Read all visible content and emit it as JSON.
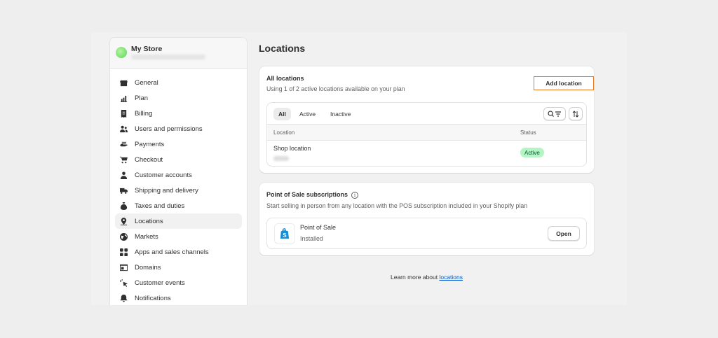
{
  "store": {
    "name": "My Store"
  },
  "sidebar": {
    "items": [
      {
        "label": "General",
        "icon": "store-icon"
      },
      {
        "label": "Plan",
        "icon": "plan-icon"
      },
      {
        "label": "Billing",
        "icon": "billing-icon"
      },
      {
        "label": "Users and permissions",
        "icon": "users-icon"
      },
      {
        "label": "Payments",
        "icon": "payments-icon"
      },
      {
        "label": "Checkout",
        "icon": "cart-icon"
      },
      {
        "label": "Customer accounts",
        "icon": "person-icon"
      },
      {
        "label": "Shipping and delivery",
        "icon": "truck-icon"
      },
      {
        "label": "Taxes and duties",
        "icon": "tax-icon"
      },
      {
        "label": "Locations",
        "icon": "location-icon",
        "active": true
      },
      {
        "label": "Markets",
        "icon": "globe-icon"
      },
      {
        "label": "Apps and sales channels",
        "icon": "apps-icon"
      },
      {
        "label": "Domains",
        "icon": "domains-icon"
      },
      {
        "label": "Customer events",
        "icon": "cursor-icon"
      },
      {
        "label": "Notifications",
        "icon": "bell-icon"
      }
    ]
  },
  "page": {
    "title": "Locations"
  },
  "locations_card": {
    "title": "All locations",
    "subtitle": "Using 1 of 2 active locations available on your plan",
    "add_button": "Add location",
    "tabs": [
      "All",
      "Active",
      "Inactive"
    ],
    "selected_tab": "All",
    "columns": {
      "location": "Location",
      "status": "Status"
    },
    "rows": [
      {
        "name": "Shop location",
        "status": "Active"
      }
    ]
  },
  "pos_card": {
    "title": "Point of Sale subscriptions",
    "subtitle": "Start selling in person from any location with the POS subscription included in your Shopify plan",
    "app_name": "Point of Sale",
    "app_status": "Installed",
    "open_button": "Open"
  },
  "footer": {
    "prefix": "Learn more about ",
    "link": "locations"
  },
  "colors": {
    "accent_outline": "#e87722",
    "badge_bg": "#b4f5c4",
    "badge_text": "#0c5132",
    "link": "#005bd3",
    "shopify_green": "#95bf47"
  }
}
